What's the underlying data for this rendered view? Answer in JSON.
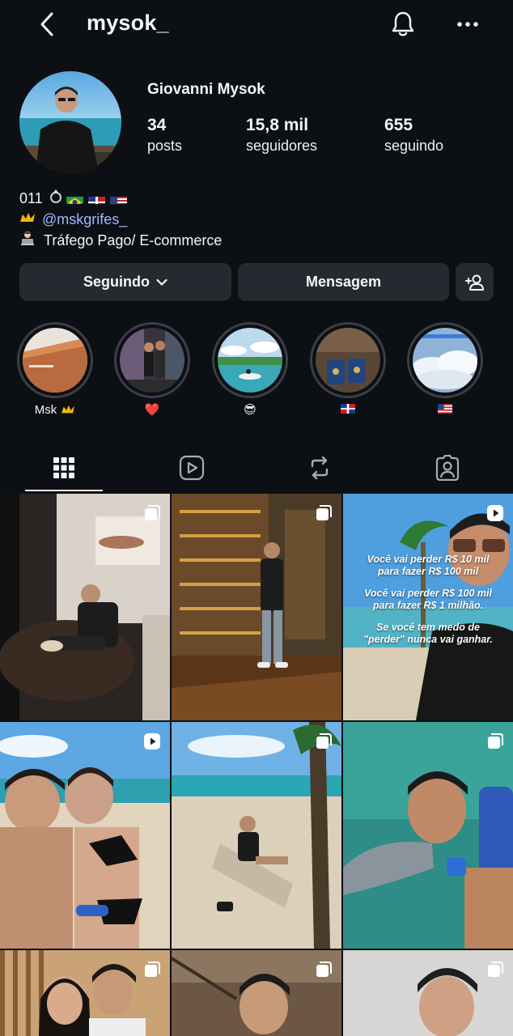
{
  "header": {
    "username": "mysok_"
  },
  "profile": {
    "name": "Giovanni Mysok",
    "stats": {
      "posts_count": "34",
      "posts_label": "posts",
      "followers_count": "15,8 mil",
      "followers_label": "seguidores",
      "following_count": "655",
      "following_label": "seguindo"
    },
    "bio": {
      "line1_text": "011",
      "line2_link": "@mskgrifes_",
      "line3_text": "Tráfego Pago/ E-commerce"
    }
  },
  "actions": {
    "following_label": "Seguindo",
    "message_label": "Mensagem"
  },
  "highlights": [
    {
      "label": "Msk"
    },
    {
      "label": "❤️"
    },
    {
      "label": "😎"
    },
    {
      "label": ""
    },
    {
      "label": ""
    }
  ],
  "posts": {
    "reel_overlay": {
      "line1a": "Você vai perder R$ 10 mil",
      "line1b": "para fazer R$ 100 mil",
      "line2a": "Você vai perder R$ 100 mil",
      "line2b": "para fazer R$ 1 milhão.",
      "line3a": "Se você tem medo de",
      "line3b": "\"perder\" nunca vai ganhar."
    }
  },
  "colors": {
    "background": "#0c1014",
    "button_bg": "#262a30",
    "link": "#a3b8ff"
  }
}
